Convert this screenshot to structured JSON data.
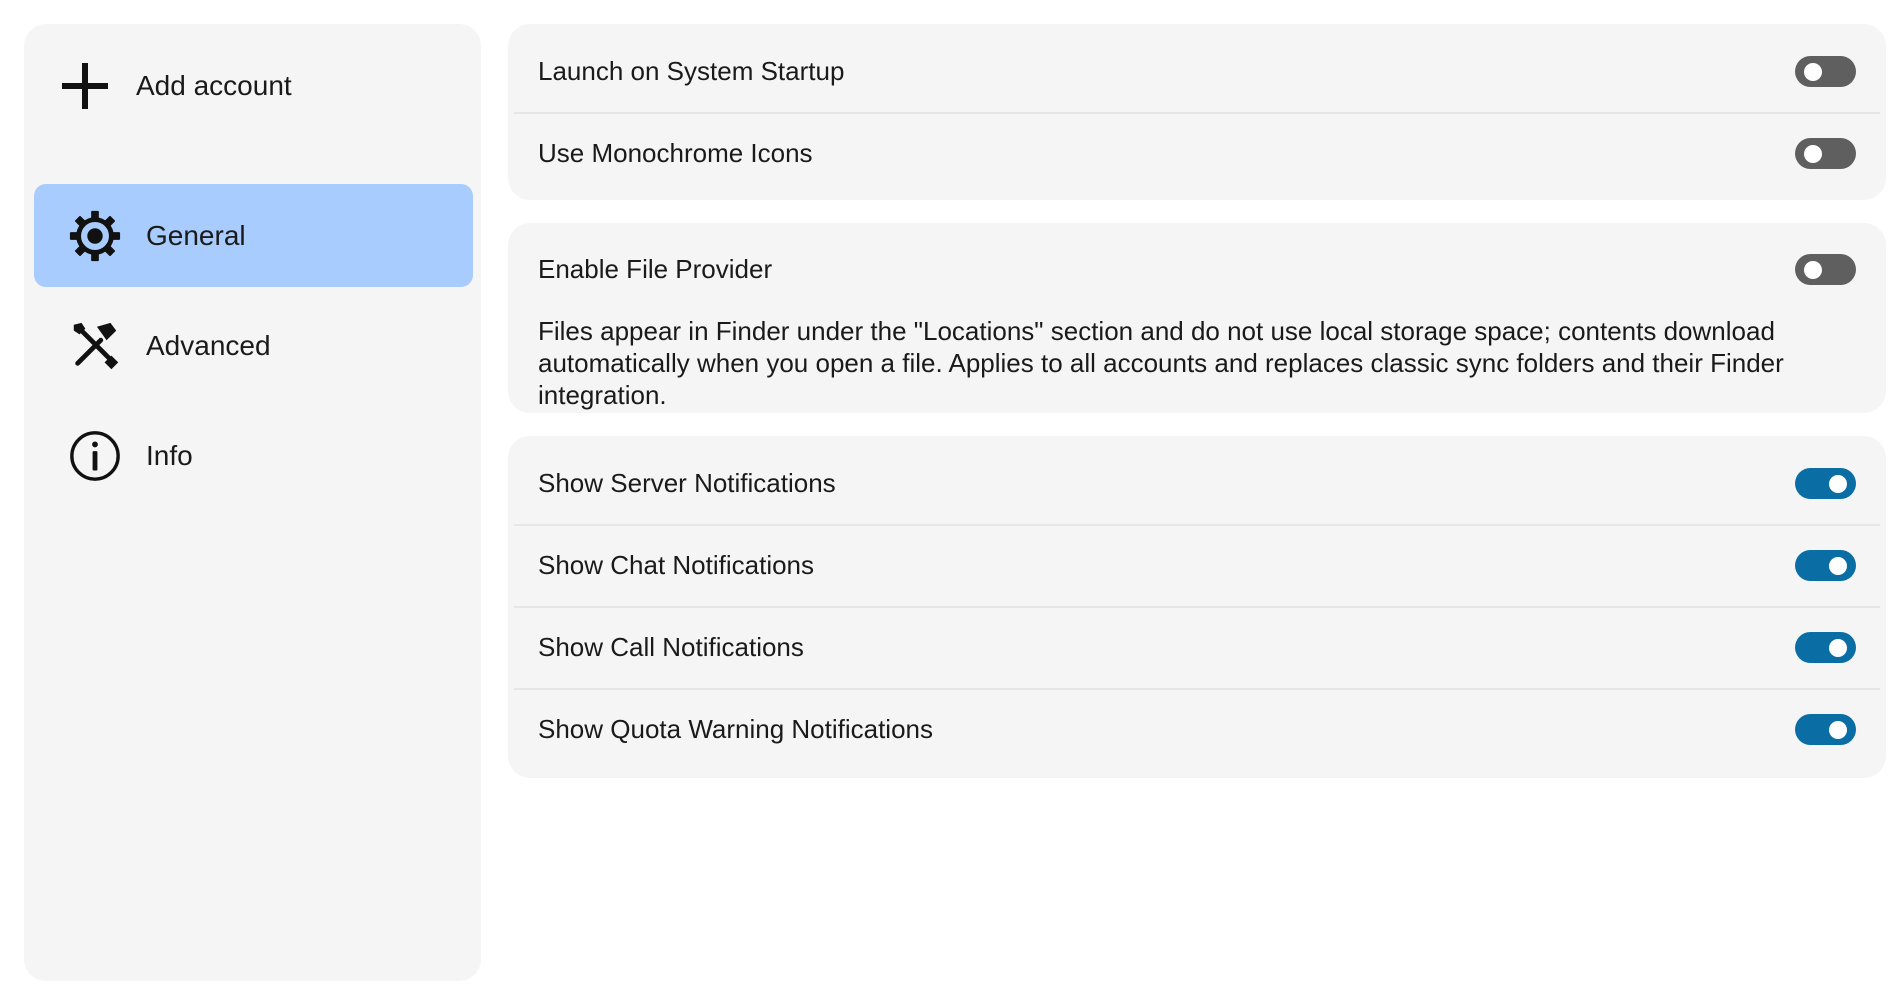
{
  "sidebar": {
    "add_account": {
      "label": "Add account",
      "icon": "plus-icon"
    },
    "items": [
      {
        "label": "General",
        "icon": "gear-icon",
        "active": true
      },
      {
        "label": "Advanced",
        "icon": "tools-icon",
        "active": false
      },
      {
        "label": "Info",
        "icon": "info-icon",
        "active": false
      }
    ]
  },
  "main": {
    "startup_group": [
      {
        "label": "Launch on System Startup",
        "enabled": false
      },
      {
        "label": "Use Monochrome Icons",
        "enabled": false
      }
    ],
    "file_provider": {
      "label": "Enable File Provider",
      "enabled": false,
      "description": "Files appear in Finder under the \"Locations\" section and do not use local storage space; contents download automatically when you open a file. Applies to all accounts and replaces classic sync folders and their Finder integration."
    },
    "notifications_group": [
      {
        "label": "Show Server Notifications",
        "enabled": true
      },
      {
        "label": "Show Chat Notifications",
        "enabled": true
      },
      {
        "label": "Show Call Notifications",
        "enabled": true
      },
      {
        "label": "Show Quota Warning Notifications",
        "enabled": true
      }
    ]
  },
  "colors": {
    "sidebar_bg": "#f5f5f5",
    "active_item": "#a8ccfd",
    "toggle_on": "#0a6ea5",
    "toggle_off": "#5f5f5f"
  }
}
